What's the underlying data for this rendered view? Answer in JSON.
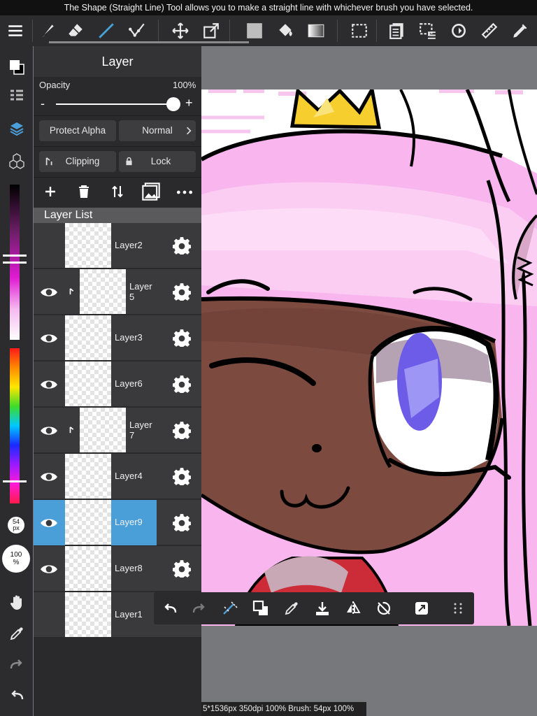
{
  "tip": "The Shape (Straight Line) Tool allows you to make a straight line with whichever brush you have selected.",
  "panel": {
    "title": "Layer",
    "opacity_label": "Opacity",
    "opacity_value": "100%",
    "opacity_fraction": 1.0,
    "minus": "-",
    "plus": "+",
    "protect_alpha": "Protect Alpha",
    "blend_mode": "Normal",
    "clipping": "Clipping",
    "lock": "Lock",
    "layer_list_title": "Layer List"
  },
  "layers": [
    {
      "name": "Layer2",
      "visible": false,
      "clipped": false,
      "selected": false
    },
    {
      "name": "Layer\n5",
      "visible": true,
      "clipped": true,
      "selected": false
    },
    {
      "name": "Layer3",
      "visible": true,
      "clipped": false,
      "selected": false
    },
    {
      "name": "Layer6",
      "visible": true,
      "clipped": false,
      "selected": false
    },
    {
      "name": "Layer\n7",
      "visible": true,
      "clipped": true,
      "selected": false
    },
    {
      "name": "Layer4",
      "visible": true,
      "clipped": false,
      "selected": false
    },
    {
      "name": "Layer9",
      "visible": true,
      "clipped": false,
      "selected": true
    },
    {
      "name": "Layer8",
      "visible": true,
      "clipped": false,
      "selected": false
    },
    {
      "name": "Layer1",
      "visible": false,
      "clipped": false,
      "selected": false
    }
  ],
  "sidebar": {
    "brush_size": "54\npx",
    "brush_opacity": "100\n%"
  },
  "status": "5*1536px 350dpi 100% Brush: 54px 100%",
  "colors": {
    "accent": "#4a9fd8",
    "selected_layer": "#4a9fd8",
    "canvas_pink": "#f7c0ee"
  }
}
